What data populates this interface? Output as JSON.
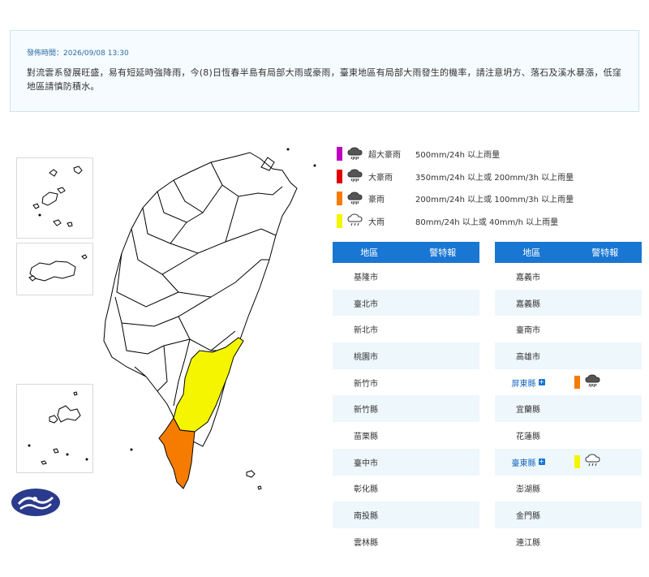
{
  "notice": {
    "time": "發佈時間：2026/09/08 13:30",
    "text": "對流雲系發展旺盛，易有短延時強降雨，今(8)日恆春半島有局部大雨或豪雨，臺東地區有局部大雨發生的機率，請注意坍方、落石及溪水暴漲，低窪地區請慎防積水。"
  },
  "legend": [
    {
      "name": "超大豪雨",
      "desc": "500mm/24h 以上雨量",
      "color": "#c000c0",
      "icon": "heavy-rain-icon"
    },
    {
      "name": "大豪雨",
      "desc": "350mm/24h 以上或 200mm/3h 以上雨量",
      "color": "#e00000",
      "icon": "heavy-rain-icon"
    },
    {
      "name": "豪雨",
      "desc": "200mm/24h 以上或 100mm/3h 以上雨量",
      "color": "#f57c00",
      "icon": "heavy-rain-icon"
    },
    {
      "name": "大雨",
      "desc": "80mm/24h 以上或 40mm/h 以上雨量",
      "color": "#f5f500",
      "icon": "rain-icon"
    }
  ],
  "table": {
    "header_area": "地區",
    "header_warn": "警特報",
    "left": [
      "基隆市",
      "臺北市",
      "新北市",
      "桃園市",
      "新竹市",
      "新竹縣",
      "苗栗縣",
      "臺中市",
      "彰化縣",
      "南投縣",
      "雲林縣"
    ],
    "right": [
      {
        "area": "嘉義市"
      },
      {
        "area": "嘉義縣"
      },
      {
        "area": "臺南市"
      },
      {
        "area": "高雄市"
      },
      {
        "area": "屏東縣",
        "link": true,
        "warn_color": "#f57c00",
        "warn_icon": "heavy-rain-icon"
      },
      {
        "area": "宜蘭縣"
      },
      {
        "area": "花蓮縣"
      },
      {
        "area": "臺東縣",
        "link": true,
        "warn_color": "#f5f500",
        "warn_icon": "rain-icon"
      },
      {
        "area": "澎湖縣"
      },
      {
        "area": "金門縣"
      },
      {
        "area": "連江縣"
      }
    ]
  },
  "map": {
    "pingtung_color": "#f57c00",
    "taitung_color": "#f5f500"
  }
}
